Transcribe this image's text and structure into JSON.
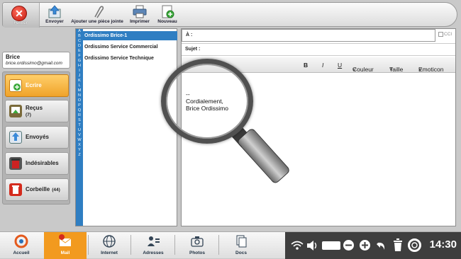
{
  "toolbar": {
    "close_label": "Fermer",
    "send_label": "Envoyer",
    "attach_label": "Ajouter une pièce jointe",
    "print_label": "Imprimer",
    "new_label": "Nouveau"
  },
  "user": {
    "name": "Brice",
    "email": "brice.ordissimo@gmail.com"
  },
  "folders": [
    {
      "label": "Ecrire",
      "count": ""
    },
    {
      "label": "Reçus",
      "count": "(7)"
    },
    {
      "label": "Envoyés",
      "count": ""
    },
    {
      "label": "Indésirables",
      "count": ""
    },
    {
      "label": "Corbeille",
      "count": "(44)"
    }
  ],
  "alphabet": [
    "A",
    "B",
    "C",
    "D",
    "E",
    "F",
    "G",
    "H",
    "I",
    "J",
    "K",
    "L",
    "M",
    "N",
    "O",
    "P",
    "Q",
    "R",
    "S",
    "T",
    "U",
    "V",
    "W",
    "X",
    "Y",
    "Z"
  ],
  "contacts": [
    "Ordissimo Brice-1",
    "Ordissimo Service Commercial",
    "Ordissimo Service Technique"
  ],
  "compose": {
    "to_label": "À :",
    "cc_label": "CCI",
    "subject_label": "Sujet :",
    "format": {
      "bold": "B",
      "italic": "I",
      "underline": "U",
      "color": "Couleur",
      "size": "Taille",
      "emoticon": "Emoticon"
    },
    "body_lines": [
      "--",
      "Cordialement,",
      "Brice Ordissimo"
    ]
  },
  "taskbar": {
    "apps": [
      {
        "label": "Accueil"
      },
      {
        "label": "Mail",
        "badge": "7"
      },
      {
        "label": "Internet"
      },
      {
        "label": "Adresses"
      },
      {
        "label": "Photos"
      },
      {
        "label": "Docs"
      }
    ],
    "clock": "14:30"
  },
  "colors": {
    "accent_orange": "#f29a1f",
    "selection_blue": "#2f7ec2",
    "close_red": "#d42a1c"
  }
}
